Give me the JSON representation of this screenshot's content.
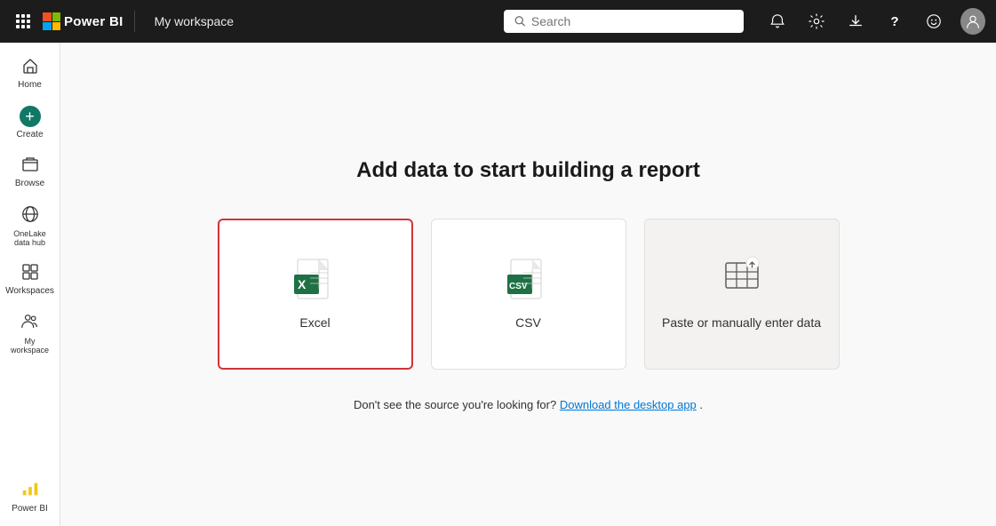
{
  "topnav": {
    "brand": "Power BI",
    "workspace": "My workspace",
    "search_placeholder": "Search",
    "icons": {
      "apps": "⋮⋮⋮",
      "notification": "🔔",
      "settings": "⚙",
      "download": "⬇",
      "help": "?",
      "smiley": "🙂"
    }
  },
  "sidebar": {
    "items": [
      {
        "id": "home",
        "label": "Home",
        "icon": "🏠"
      },
      {
        "id": "create",
        "label": "Create",
        "icon": "+"
      },
      {
        "id": "browse",
        "label": "Browse",
        "icon": "📁"
      },
      {
        "id": "onelake",
        "label": "OneLake data hub",
        "icon": "⬡"
      },
      {
        "id": "workspaces",
        "label": "Workspaces",
        "icon": "⊞"
      },
      {
        "id": "myworkspace",
        "label": "My workspace",
        "icon": "👥"
      },
      {
        "id": "powerbi",
        "label": "Power BI",
        "icon": "📊"
      }
    ]
  },
  "main": {
    "title": "Add data to start building a report",
    "cards": [
      {
        "id": "excel",
        "label": "Excel",
        "selected": true
      },
      {
        "id": "csv",
        "label": "CSV",
        "selected": false
      },
      {
        "id": "paste",
        "label": "Paste or manually enter\ndata",
        "selected": false
      }
    ],
    "bottom_note": "Don't see the source you're looking for?",
    "bottom_link": "Download the desktop app",
    "bottom_suffix": "."
  }
}
